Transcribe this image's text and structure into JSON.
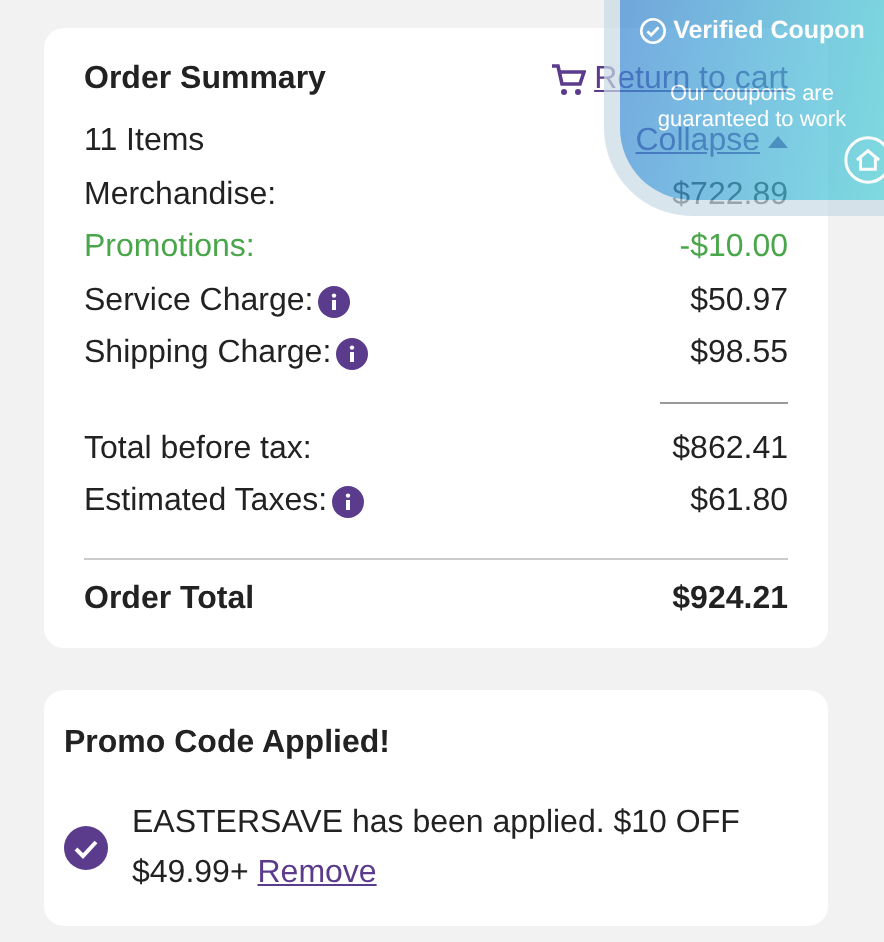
{
  "summary": {
    "title": "Order Summary",
    "return_link": "Return to cart",
    "item_count": "11 Items",
    "collapse_link": "Collapse",
    "lines": [
      {
        "label": "Merchandise:",
        "value": "$722.89",
        "kind": "plain",
        "info": false
      },
      {
        "label": "Promotions:",
        "value": "-$10.00",
        "kind": "discount",
        "info": false
      },
      {
        "label": "Service Charge:",
        "value": "$50.97",
        "kind": "plain",
        "info": true
      },
      {
        "label": "Shipping Charge:",
        "value": "$98.55",
        "kind": "plain",
        "info": true
      }
    ],
    "totals": [
      {
        "label": "Total before tax:",
        "value": "$862.41",
        "info": false
      },
      {
        "label": "Estimated Taxes:",
        "value": "$61.80",
        "info": true
      }
    ],
    "order_total": {
      "label": "Order Total",
      "value": "$924.21"
    }
  },
  "promo": {
    "title": "Promo Code Applied!",
    "message": "EASTERSAVE has been applied. $10 OFF $49.99+",
    "remove_link": "Remove"
  },
  "coupon_banner": {
    "title": "Verified Coupon",
    "subtitle": "Our coupons are guaranteed to work"
  }
}
